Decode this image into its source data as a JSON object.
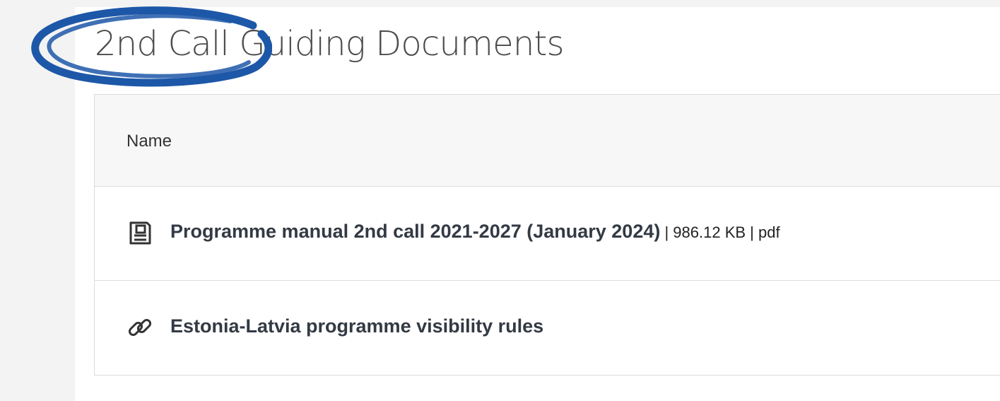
{
  "page": {
    "heading": "2nd Call Guiding Documents"
  },
  "table": {
    "column_header": "Name",
    "rows": [
      {
        "icon": "document-icon",
        "title": "Programme manual 2nd call 2021-2027 (January 2024)",
        "meta": " | 986.12 KB | pdf"
      },
      {
        "icon": "link-icon",
        "title": "Estonia-Latvia programme visibility rules",
        "meta": ""
      }
    ]
  },
  "colors": {
    "annotation": "#1d57a8",
    "heading": "#4b4b4b",
    "border": "#dcdcdc",
    "header_background": "#f7f7f7"
  }
}
